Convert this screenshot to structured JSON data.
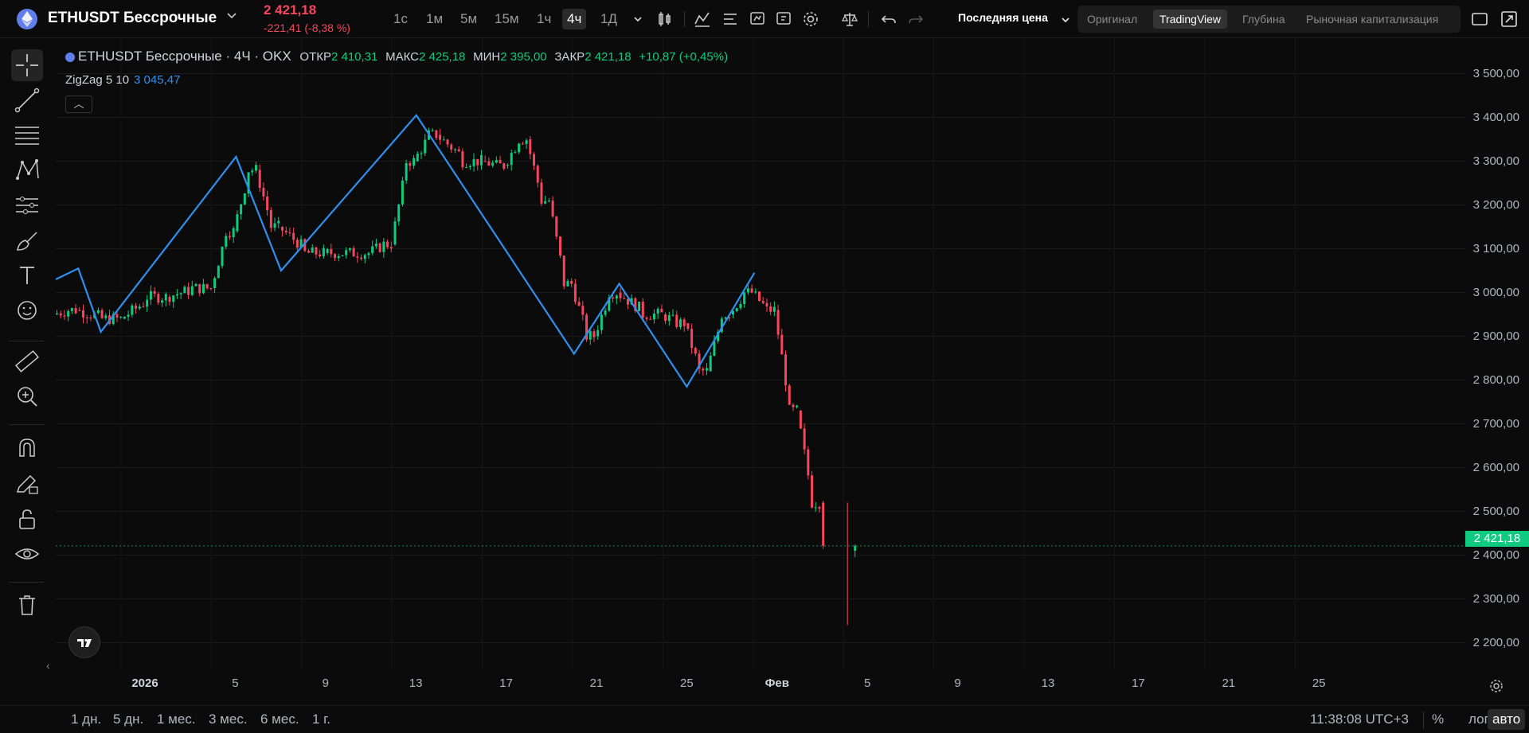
{
  "header": {
    "symbol": "ETHUSDT Бессрочные",
    "symbol_icon": "ethereum-icon",
    "last_price": "2 421,18",
    "price_change": "-221,41 (-8,38 %)",
    "timeframes": [
      "1с",
      "1м",
      "5м",
      "15м",
      "1ч",
      "4ч",
      "1Д"
    ],
    "active_timeframe": "4ч",
    "price_type": "Последняя цена",
    "view_tabs": [
      "Оригинал",
      "TradingView",
      "Глубина",
      "Рыночная капитализация"
    ],
    "active_view": "TradingView",
    "colors": {
      "up": "#0ecb81",
      "down": "#f6465d",
      "zigzag": "#2f8fee",
      "background": "#0b0b0b"
    }
  },
  "legend": {
    "title": "ETHUSDT Бессрочные · 4Ч · OKX",
    "open_label": "ОТКР",
    "open": "2 410,31",
    "high_label": "МАКС",
    "high": "2 425,18",
    "low_label": "МИН",
    "low": "2 395,00",
    "close_label": "ЗАКР",
    "close": "2 421,18",
    "change": "+10,87 (+0,45%)",
    "indicator_name": "ZigZag 5 10",
    "indicator_value": "3 045,47"
  },
  "price_scale": {
    "ticks": [
      "3 500,00",
      "3 400,00",
      "3 300,00",
      "3 200,00",
      "3 100,00",
      "3 000,00",
      "2 900,00",
      "2 800,00",
      "2 700,00",
      "2 600,00",
      "2 500,00",
      "2 400,00",
      "2 300,00",
      "2 200,00"
    ],
    "current_price_label": "2 421,18"
  },
  "time_scale": {
    "ticks": [
      "2026",
      "5",
      "9",
      "13",
      "17",
      "21",
      "25",
      "Фев",
      "5",
      "9",
      "13",
      "17",
      "21",
      "25"
    ]
  },
  "chart_data": {
    "type": "candlestick",
    "title": "ETHUSDT Бессрочные · 4Ч · OKX",
    "y_range": [
      2150,
      3530
    ],
    "x_range": [
      "2025-12-29",
      "2026-02-28"
    ],
    "zigzag_series": {
      "name": "ZigZag 5 10",
      "points": [
        {
          "date": "2025-12-29",
          "price": 3030
        },
        {
          "date": "2025-12-30",
          "price": 3055
        },
        {
          "date": "2025-12-31",
          "price": 2910
        },
        {
          "date": "2026-01-06",
          "price": 3310
        },
        {
          "date": "2026-01-08",
          "price": 3050
        },
        {
          "date": "2026-01-14",
          "price": 3405
        },
        {
          "date": "2026-01-21",
          "price": 2860
        },
        {
          "date": "2026-01-23",
          "price": 3020
        },
        {
          "date": "2026-01-26",
          "price": 2785
        },
        {
          "date": "2026-01-29",
          "price": 3045
        }
      ]
    },
    "candles_ohlc_approx": [
      {
        "date": "2025-12-29",
        "o": 2950,
        "h": 3000,
        "l": 2930,
        "c": 2960
      },
      {
        "date": "2025-12-30",
        "o": 2960,
        "h": 3050,
        "l": 2910,
        "c": 2940
      },
      {
        "date": "2026-01-01",
        "o": 2940,
        "h": 3010,
        "l": 2930,
        "c": 2990
      },
      {
        "date": "2026-01-03",
        "o": 2990,
        "h": 3030,
        "l": 2960,
        "c": 3010
      },
      {
        "date": "2026-01-05",
        "o": 3010,
        "h": 3150,
        "l": 3000,
        "c": 3140
      },
      {
        "date": "2026-01-06",
        "o": 3140,
        "h": 3300,
        "l": 3120,
        "c": 3280
      },
      {
        "date": "2026-01-07",
        "o": 3280,
        "h": 3300,
        "l": 3140,
        "c": 3150
      },
      {
        "date": "2026-01-08",
        "o": 3150,
        "h": 3160,
        "l": 3050,
        "c": 3090
      },
      {
        "date": "2026-01-10",
        "o": 3090,
        "h": 3110,
        "l": 3060,
        "c": 3090
      },
      {
        "date": "2026-01-12",
        "o": 3090,
        "h": 3150,
        "l": 3060,
        "c": 3110
      },
      {
        "date": "2026-01-13",
        "o": 3110,
        "h": 3320,
        "l": 3100,
        "c": 3300
      },
      {
        "date": "2026-01-14",
        "o": 3300,
        "h": 3400,
        "l": 3280,
        "c": 3360
      },
      {
        "date": "2026-01-15",
        "o": 3360,
        "h": 3370,
        "l": 3280,
        "c": 3300
      },
      {
        "date": "2026-01-17",
        "o": 3300,
        "h": 3320,
        "l": 3260,
        "c": 3290
      },
      {
        "date": "2026-01-18",
        "o": 3290,
        "h": 3370,
        "l": 3280,
        "c": 3350
      },
      {
        "date": "2026-01-19",
        "o": 3350,
        "h": 3360,
        "l": 3200,
        "c": 3210
      },
      {
        "date": "2026-01-20",
        "o": 3210,
        "h": 3220,
        "l": 3000,
        "c": 3020
      },
      {
        "date": "2026-01-21",
        "o": 3020,
        "h": 3040,
        "l": 2860,
        "c": 2900
      },
      {
        "date": "2026-01-22",
        "o": 2900,
        "h": 3060,
        "l": 2890,
        "c": 3000
      },
      {
        "date": "2026-01-23",
        "o": 3000,
        "h": 3010,
        "l": 2920,
        "c": 2950
      },
      {
        "date": "2026-01-25",
        "o": 2950,
        "h": 2970,
        "l": 2920,
        "c": 2930
      },
      {
        "date": "2026-01-26",
        "o": 2930,
        "h": 2940,
        "l": 2785,
        "c": 2820
      },
      {
        "date": "2026-01-27",
        "o": 2820,
        "h": 2960,
        "l": 2810,
        "c": 2950
      },
      {
        "date": "2026-01-28",
        "o": 2950,
        "h": 3045,
        "l": 2940,
        "c": 3000
      },
      {
        "date": "2026-01-29",
        "o": 3000,
        "h": 3010,
        "l": 2940,
        "c": 2960
      },
      {
        "date": "2026-01-30",
        "o": 2960,
        "h": 2970,
        "l": 2700,
        "c": 2730
      },
      {
        "date": "2026-01-31",
        "o": 2730,
        "h": 2740,
        "l": 2500,
        "c": 2520
      },
      {
        "date": "2026-02-01",
        "o": 2520,
        "h": 2530,
        "l": 2240,
        "c": 2410
      },
      {
        "date": "2026-02-01",
        "o": 2410,
        "h": 2425,
        "l": 2395,
        "c": 2421
      }
    ]
  },
  "left_toolbar": {
    "tools": [
      "crosshair-icon",
      "trendline-icon",
      "fib-lines-icon",
      "pattern-icon",
      "forecast-icon",
      "brush-icon",
      "text-icon",
      "emoji-icon",
      "ruler-icon",
      "zoom-in-icon",
      "magnet-icon",
      "lock-draw-icon",
      "unlock-icon",
      "eye-icon",
      "trash-icon"
    ]
  },
  "bottom_bar": {
    "ranges": [
      "1 дн.",
      "5 дн.",
      "1 мес.",
      "3 мес.",
      "6 мес.",
      "1 г."
    ],
    "clock": "11:38:08 UTC+3",
    "percent_label": "%",
    "log_label": "лог",
    "auto_label": "авто"
  }
}
